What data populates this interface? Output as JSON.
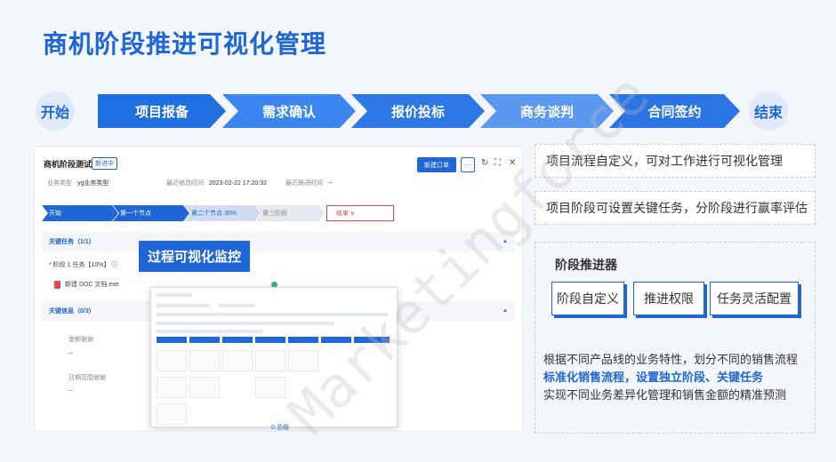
{
  "title": "商机阶段推进可视化管理",
  "flow": {
    "start": "开始",
    "end": "结束",
    "steps": [
      "项目报备",
      "需求确认",
      "报价投标",
      "商务谈判",
      "合同签约"
    ]
  },
  "panel": {
    "name": "商机阶段测试",
    "status": "新进中",
    "meta_type_label": "业务类型",
    "meta_type_value": "yg业务类型",
    "meta_time_label": "最近修改时间",
    "meta_time_value": "2023-02-22 17:20:32",
    "meta_follow_label": "最近跟进时间",
    "meta_follow_value": "--",
    "new_order": "新建订单",
    "more": "···",
    "icons": [
      "refresh-icon",
      "expand-icon",
      "close-icon"
    ],
    "stages": [
      "开始",
      "第一个节点",
      "第二个节点 30%",
      "第三阶段"
    ],
    "lose": "结束 ∨",
    "tasks_header": "关键任务（1/1）",
    "task_item": "* 阶段 1 任务【10%】 ⓘ",
    "task_doc": "新建 DOC 文档.exe",
    "info_header": "关键信息（0/3）",
    "field_amount": "金额谢谢",
    "field_amount_value": "--",
    "field_date": "日期范围谢谢",
    "field_date_value": "--",
    "footer_link": "0 总结"
  },
  "overlay_label": "过程可视化监控",
  "features": {
    "f1": "项目流程自定义，可对工作进行可视化管理",
    "f2": "项目阶段可设置关键任务，分阶段进行赢率评估"
  },
  "pusher": {
    "title": "阶段推进器",
    "tags": [
      "阶段自定义",
      "推进权限",
      "任务灵活配置"
    ],
    "line1": "根据不同产品线的业务特性，划分不同的销售流程",
    "line2": "标准化销售流程，设置独立阶段、关键任务",
    "line3": "实现不同业务差异化管理和销售金额的精准预测"
  },
  "watermark": "Marketingforce",
  "colors": {
    "accent": "#1f66d8",
    "arrow_shades": [
      "#1f6fe0",
      "#3a85ee",
      "#2d78e6",
      "#5b98ef",
      "#2a74e4"
    ]
  }
}
